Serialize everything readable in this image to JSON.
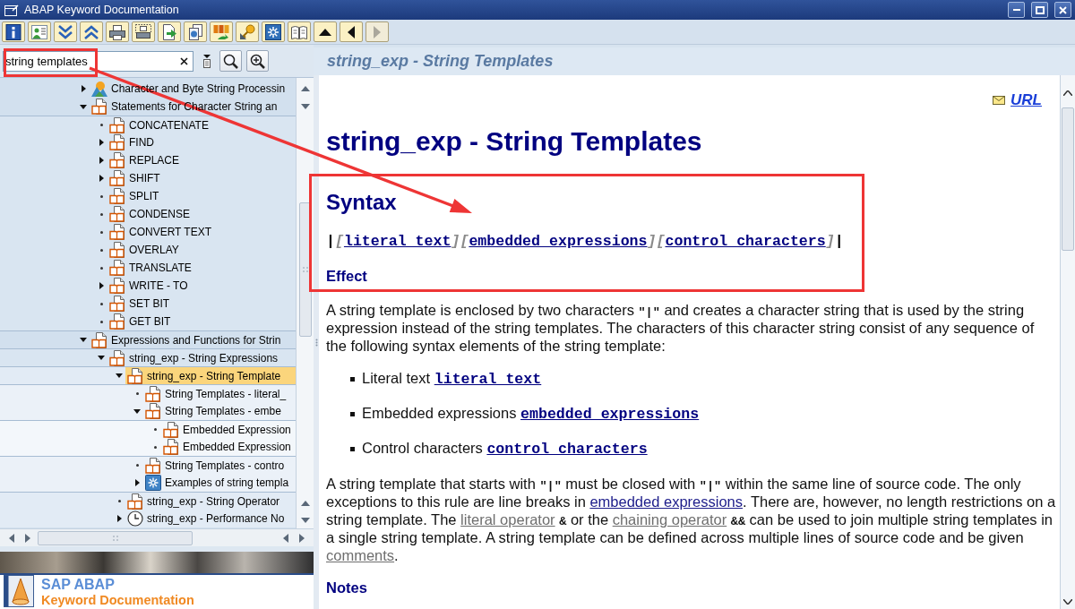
{
  "window": {
    "title": "ABAP Keyword Documentation"
  },
  "toolbar": {
    "buttons": [
      {
        "kind": "info",
        "disabled": false
      },
      {
        "kind": "person-list",
        "disabled": false
      },
      {
        "kind": "expand",
        "disabled": false
      },
      {
        "kind": "collapse",
        "disabled": false
      },
      {
        "kind": "printer",
        "disabled": false
      },
      {
        "kind": "printer-dotted",
        "disabled": false
      },
      {
        "kind": "document-arrow",
        "disabled": false
      },
      {
        "kind": "document-copy",
        "disabled": false
      },
      {
        "kind": "blocks-arrow",
        "disabled": false
      },
      {
        "kind": "key",
        "disabled": false
      },
      {
        "kind": "gear-box",
        "disabled": false
      },
      {
        "kind": "book",
        "disabled": false
      },
      {
        "kind": "up",
        "disabled": false
      },
      {
        "kind": "left",
        "disabled": false
      },
      {
        "kind": "right",
        "disabled": true
      }
    ]
  },
  "search": {
    "value": "string templates"
  },
  "tree": {
    "items": [
      {
        "label": "Character and Byte String Processin",
        "kind": "landscape",
        "expanded": false,
        "selected": false
      },
      {
        "label": "Statements for Character String an",
        "kind": "book",
        "expanded": true,
        "selected": false,
        "children": [
          {
            "label": "CONCATENATE",
            "kind": "book",
            "selected": false
          },
          {
            "label": "FIND",
            "kind": "book",
            "expanded": false,
            "selected": false
          },
          {
            "label": "REPLACE",
            "kind": "book",
            "expanded": false,
            "selected": false
          },
          {
            "label": "SHIFT",
            "kind": "book",
            "expanded": false,
            "selected": false
          },
          {
            "label": "SPLIT",
            "kind": "book",
            "selected": false
          },
          {
            "label": "CONDENSE",
            "kind": "book",
            "selected": false
          },
          {
            "label": "CONVERT TEXT",
            "kind": "book",
            "selected": false
          },
          {
            "label": "OVERLAY",
            "kind": "book",
            "selected": false
          },
          {
            "label": "TRANSLATE",
            "kind": "book",
            "selected": false
          },
          {
            "label": "WRITE - TO",
            "kind": "book",
            "expanded": false,
            "selected": false
          },
          {
            "label": "SET BIT",
            "kind": "book",
            "selected": false
          },
          {
            "label": "GET BIT",
            "kind": "book",
            "selected": false
          }
        ]
      },
      {
        "label": "Expressions and Functions for Strin",
        "kind": "book",
        "expanded": true,
        "selected": false,
        "children": [
          {
            "label": "string_exp - String Expressions",
            "kind": "book",
            "expanded": true,
            "selected": false,
            "children": [
              {
                "label": "string_exp - String Template",
                "kind": "book",
                "expanded": true,
                "selected": true,
                "children": [
                  {
                    "label": "String Templates - literal_",
                    "kind": "book",
                    "selected": false
                  },
                  {
                    "label": "String Templates - embe",
                    "kind": "book",
                    "expanded": true,
                    "selected": false,
                    "children": [
                      {
                        "label": "Embedded Expression",
                        "kind": "book",
                        "selected": false
                      },
                      {
                        "label": "Embedded Expression",
                        "kind": "book",
                        "selected": false
                      }
                    ]
                  },
                  {
                    "label": "String Templates - contro",
                    "kind": "book",
                    "selected": false
                  },
                  {
                    "label": "Examples of string templa",
                    "kind": "gear-box",
                    "expanded": false,
                    "selected": false
                  }
                ]
              },
              {
                "label": "string_exp - String Operator",
                "kind": "book",
                "selected": false
              },
              {
                "label": "string_exp - Performance No",
                "kind": "clock",
                "expanded": false,
                "selected": false
              }
            ]
          }
        ]
      }
    ]
  },
  "banner": {
    "title": "SAP ABAP",
    "subtitle": "Keyword Documentation"
  },
  "document": {
    "header": "string_exp - String Templates",
    "url_link": "URL",
    "heading": "string_exp - String Templates",
    "syntax_heading": "Syntax",
    "syntax": [
      {
        "kind": "delimiter",
        "text": "|"
      },
      {
        "kind": "bracket",
        "text": "["
      },
      {
        "kind": "link",
        "text": "literal_text"
      },
      {
        "kind": "bracket",
        "text": "]"
      },
      {
        "kind": "bracket",
        "text": "["
      },
      {
        "kind": "link",
        "text": "embedded_expressions"
      },
      {
        "kind": "bracket",
        "text": "]"
      },
      {
        "kind": "bracket",
        "text": "["
      },
      {
        "kind": "link",
        "text": "control_characters"
      },
      {
        "kind": "bracket",
        "text": "]"
      },
      {
        "kind": "delimiter",
        "text": "|"
      }
    ],
    "effect_heading": "Effect",
    "intro": [
      {
        "kind": "text",
        "text": "A string template is enclosed by two characters "
      },
      {
        "kind": "code",
        "text": "\"|\""
      },
      {
        "kind": "text",
        "text": " and creates a character string that is used by the string expression instead of the string templates. The characters of this character string consist of any sequence of the following syntax elements of the string template:"
      }
    ],
    "bullets": [
      {
        "label": "Literal text",
        "link": "literal_text"
      },
      {
        "label": "Embedded expressions",
        "link": "embedded_expressions"
      },
      {
        "label": "Control characters",
        "link": "control_characters"
      }
    ],
    "body": [
      {
        "kind": "text",
        "text": "A string template that starts with "
      },
      {
        "kind": "code",
        "text": "\"|\""
      },
      {
        "kind": "text",
        "text": " must be closed with "
      },
      {
        "kind": "code",
        "text": "\"|\""
      },
      {
        "kind": "text",
        "text": " within the same line of source code. The only exceptions to this rule are line breaks in "
      },
      {
        "kind": "link",
        "text": "embedded expressions",
        "visited": false
      },
      {
        "kind": "text",
        "text": ". There are, however, no length restrictions on a string template. The "
      },
      {
        "kind": "link",
        "text": "literal operator",
        "visited": true
      },
      {
        "kind": "code",
        "text": " &"
      },
      {
        "kind": "text",
        "text": " or the "
      },
      {
        "kind": "link",
        "text": "chaining operator",
        "visited": true
      },
      {
        "kind": "code",
        "text": " &&"
      },
      {
        "kind": "text",
        "text": " can be used to join multiple string templates in a single string template. A string template can be defined across multiple lines of source code and be given "
      },
      {
        "kind": "link",
        "text": "comments",
        "visited": true
      },
      {
        "kind": "text",
        "text": "."
      }
    ],
    "notes_heading": "Notes"
  }
}
